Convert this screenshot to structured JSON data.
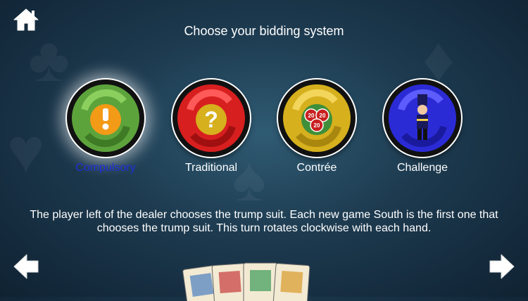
{
  "header": {
    "title": "Choose your bidding system",
    "home_icon": "home-icon"
  },
  "options": [
    {
      "label": "Compulsory",
      "icon": "exclamation-icon",
      "color": "#5da33c",
      "selected": true
    },
    {
      "label": "Traditional",
      "icon": "question-icon",
      "color": "#d81f1f",
      "selected": false
    },
    {
      "label": "Contrée",
      "icon": "chips-icon",
      "color": "#d6b01d",
      "selected": false
    },
    {
      "label": "Challenge",
      "icon": "nutcracker-icon",
      "color": "#2b2bd6",
      "selected": false
    }
  ],
  "chips_text": "20",
  "description": "The player left of the dealer chooses the trump suit. Each new game South is the first one that chooses the trump suit. This turn rotates clockwise with each hand.",
  "navigation": {
    "prev_icon": "arrow-left-icon",
    "next_icon": "arrow-right-icon"
  },
  "colors": {
    "selected_label": "#1f2fd8",
    "background": "#1d3a4f"
  }
}
